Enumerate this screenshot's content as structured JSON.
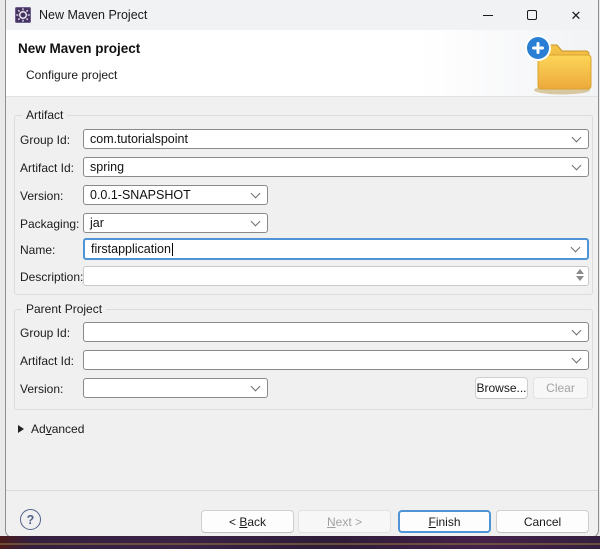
{
  "window": {
    "title": "New Maven Project",
    "icons": {
      "close_glyph": "✕"
    }
  },
  "header": {
    "title": "New Maven project",
    "subtitle": "Configure project"
  },
  "artifact": {
    "legend": "Artifact",
    "group_id": {
      "label": "Group Id:",
      "value": "com.tutorialspoint"
    },
    "artifact_id": {
      "label": "Artifact Id:",
      "value": "spring"
    },
    "version": {
      "label": "Version:",
      "value": "0.0.1-SNAPSHOT"
    },
    "packaging": {
      "label": "Packaging:",
      "value": "jar"
    },
    "name": {
      "label": "Name:",
      "value": "firstapplication"
    },
    "description": {
      "label": "Description:",
      "value": ""
    }
  },
  "parent_project": {
    "legend": "Parent Project",
    "group_id": {
      "label": "Group Id:",
      "value": ""
    },
    "artifact_id": {
      "label": "Artifact Id:",
      "value": ""
    },
    "version": {
      "label": "Version:",
      "value": ""
    },
    "browse_label": "Browse...",
    "clear_label": "Clear"
  },
  "advanced": {
    "pre": "Ad",
    "mnemonic": "v",
    "post": "anced"
  },
  "footer": {
    "help_glyph": "?",
    "back": {
      "pre": "< ",
      "mnemonic": "B",
      "post": "ack"
    },
    "next": {
      "pre": "",
      "mnemonic": "N",
      "post": "ext >"
    },
    "finish": {
      "pre": "",
      "mnemonic": "F",
      "post": "inish"
    },
    "cancel_label": "Cancel"
  },
  "colors": {
    "focus_border": "#4f94d5",
    "folder_gold": "#f2b52a",
    "plus_circle_blue": "#2a7fd4",
    "titlebar_icon_purple": "#44325f"
  }
}
